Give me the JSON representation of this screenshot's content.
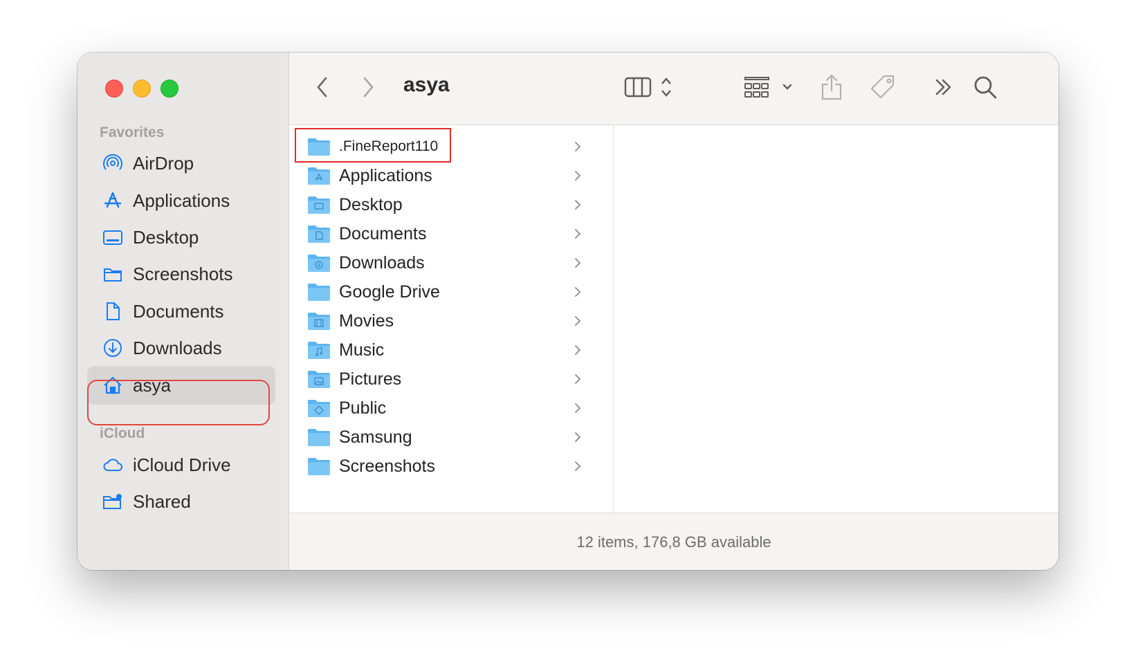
{
  "window": {
    "title": "asya",
    "status": "12 items, 176,8 GB available"
  },
  "toolbar": {
    "back_icon": "chevron-left-icon",
    "forward_icon": "chevron-right-icon",
    "view_icon": "column-view-icon",
    "group_icon": "group-grid-icon",
    "share_icon": "share-icon",
    "tag_icon": "tag-icon",
    "more_icon": "double-chevron-icon",
    "search_icon": "search-icon"
  },
  "sidebar": {
    "favorites_title": "Favorites",
    "favorites": [
      {
        "label": "AirDrop",
        "icon": "airdrop-icon"
      },
      {
        "label": "Applications",
        "icon": "applications-icon"
      },
      {
        "label": "Desktop",
        "icon": "desktop-icon"
      },
      {
        "label": "Screenshots",
        "icon": "folder-icon"
      },
      {
        "label": "Documents",
        "icon": "document-icon"
      },
      {
        "label": "Downloads",
        "icon": "download-icon"
      },
      {
        "label": "asya",
        "icon": "home-icon",
        "selected": true
      }
    ],
    "icloud_title": "iCloud",
    "icloud": [
      {
        "label": "iCloud Drive",
        "icon": "cloud-icon"
      },
      {
        "label": "Shared",
        "icon": "shared-folder-icon"
      }
    ]
  },
  "files": [
    {
      "name": ".FineReport110",
      "icon": "folder-icon",
      "highlighted": true
    },
    {
      "name": "Applications",
      "icon": "applications-folder-icon"
    },
    {
      "name": "Desktop",
      "icon": "desktop-folder-icon"
    },
    {
      "name": "Documents",
      "icon": "documents-folder-icon"
    },
    {
      "name": "Downloads",
      "icon": "downloads-folder-icon"
    },
    {
      "name": "Google Drive",
      "icon": "folder-icon"
    },
    {
      "name": "Movies",
      "icon": "movies-folder-icon"
    },
    {
      "name": "Music",
      "icon": "music-folder-icon"
    },
    {
      "name": "Pictures",
      "icon": "pictures-folder-icon"
    },
    {
      "name": "Public",
      "icon": "public-folder-icon"
    },
    {
      "name": "Samsung",
      "icon": "folder-icon"
    },
    {
      "name": "Screenshots",
      "icon": "folder-icon"
    }
  ],
  "colors": {
    "accent": "#1a7cf0",
    "folder": "#5db4ef",
    "highlight": "#e22a2a"
  }
}
